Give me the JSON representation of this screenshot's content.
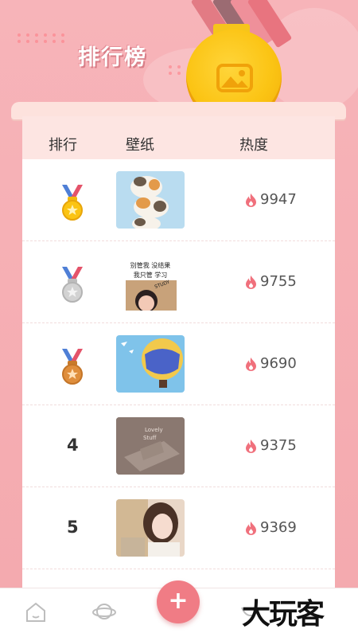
{
  "header": {
    "title": "排行榜"
  },
  "table": {
    "columns": {
      "rank": "排行",
      "wallpaper": "壁纸",
      "heat": "热度"
    },
    "rows": [
      {
        "rank": "1",
        "medal": "gold",
        "thumbnail": "cats-wallpaper",
        "heat": "9947"
      },
      {
        "rank": "2",
        "medal": "silver",
        "thumbnail": "study-girl-wallpaper",
        "thumb_text": [
          "别管我 没结果",
          "我只管 学习"
        ],
        "thumb_sticker": "STUDY",
        "heat": "9755"
      },
      {
        "rank": "3",
        "medal": "bronze",
        "thumbnail": "hot-air-balloon-wallpaper",
        "heat": "9690"
      },
      {
        "rank": "4",
        "medal": "",
        "thumbnail": "book-photo-wallpaper",
        "thumb_text": [
          "Lovely",
          "Stuff"
        ],
        "heat": "9375"
      },
      {
        "rank": "5",
        "medal": "",
        "thumbnail": "girl-portrait-wallpaper",
        "heat": "9369"
      }
    ]
  },
  "nav": {
    "items": [
      "home-icon",
      "planet-icon",
      "add-button",
      "profile-icon"
    ],
    "add_label": "+"
  },
  "watermark": "大玩客",
  "colors": {
    "background": "#f7b4b9",
    "accent": "#f07c85",
    "gold": "#fbc414",
    "silver": "#c9c9c9",
    "bronze": "#d98a3a",
    "flame": "#f0707c"
  }
}
